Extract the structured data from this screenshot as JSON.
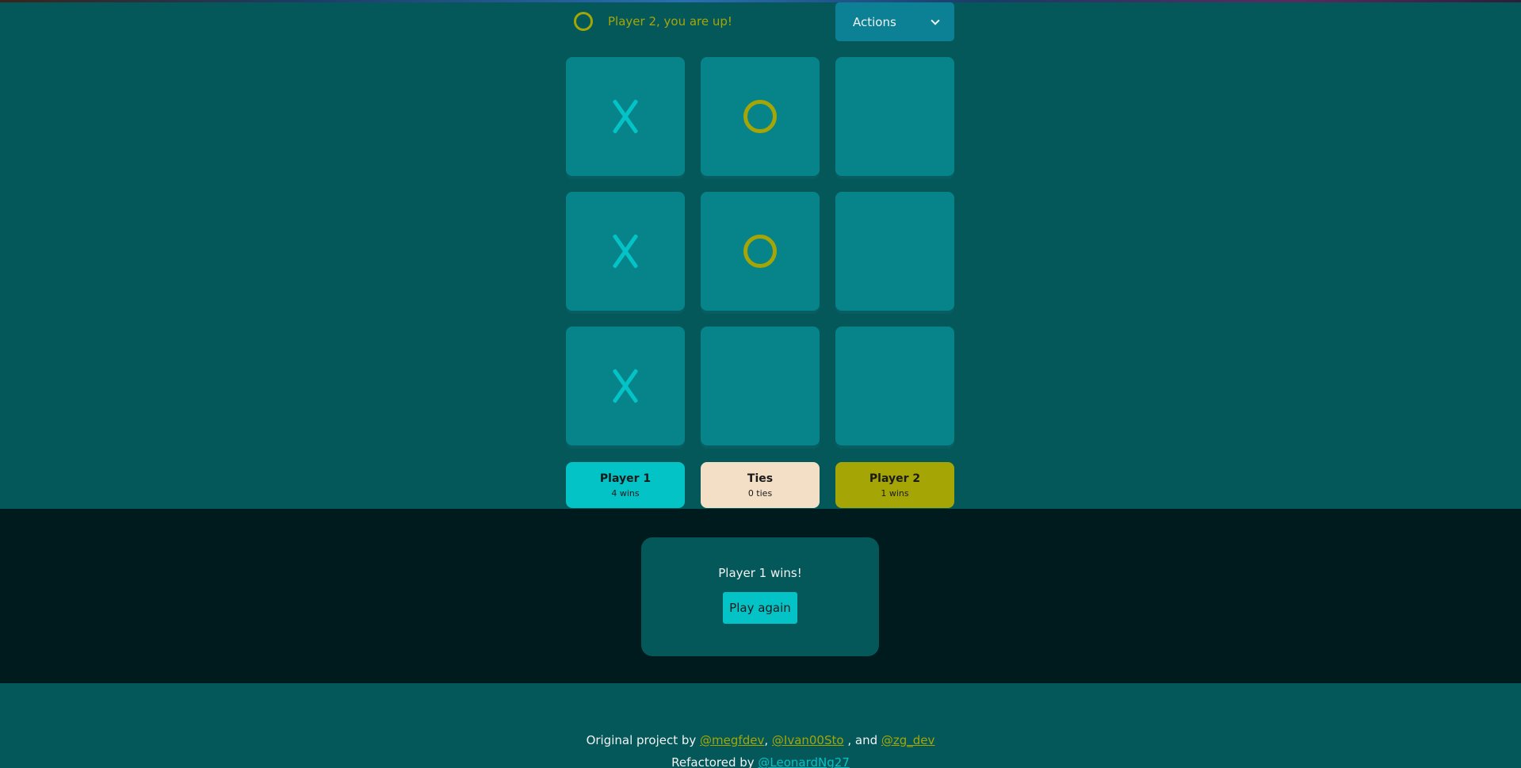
{
  "turn": {
    "text": "Player 2, you are up!",
    "icon": "o-icon",
    "color": "#a5a605"
  },
  "actions": {
    "label": "Actions",
    "icon": "chevron-down-icon"
  },
  "board": {
    "cells": [
      "X",
      "O",
      "",
      "X",
      "O",
      "",
      "X",
      "",
      ""
    ]
  },
  "scores": {
    "player1": {
      "title": "Player 1",
      "count": "4 wins",
      "color": "#03c3c7"
    },
    "ties": {
      "title": "Ties",
      "count": "0 ties",
      "color": "#f3dfc6"
    },
    "player2": {
      "title": "Player 2",
      "count": "1 wins",
      "color": "#a5a605"
    }
  },
  "modal": {
    "message": "Player 1 wins!",
    "button_label": "Play again"
  },
  "footer": {
    "line1_prefix": "Original project by",
    "author1": "@megfdev",
    "sep1": ",",
    "author2": "@Ivan00Sto",
    "sep2": ", and",
    "author3": "@zg_dev",
    "line2_prefix": "Refactored by",
    "refactor_author": "@LeonardNg27"
  },
  "colors": {
    "background": "#04585a",
    "square": "#07848a",
    "x_mark": "#03c3c7",
    "o_mark": "#a5a605",
    "modal_backdrop": "#001b1d"
  }
}
